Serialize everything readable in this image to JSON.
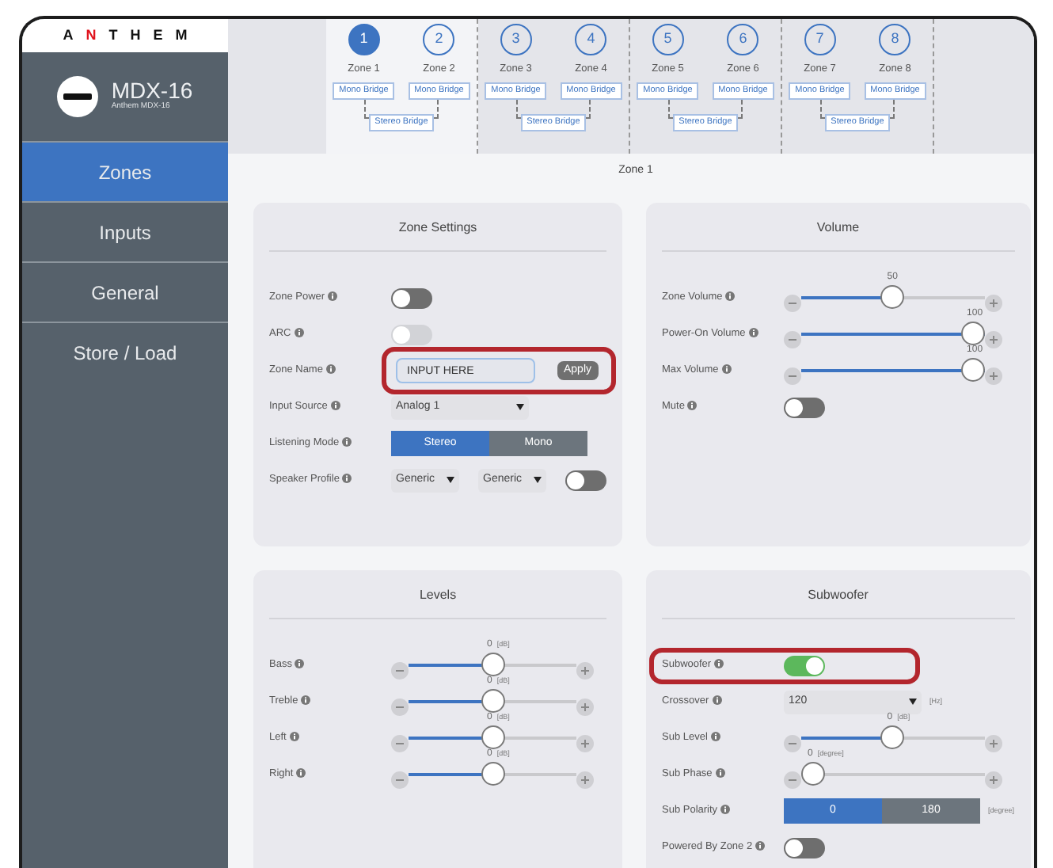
{
  "logo": {
    "letters": [
      {
        "char": "A",
        "accent": false
      },
      {
        "char": "N",
        "accent": true
      },
      {
        "char": "T",
        "accent": false
      },
      {
        "char": "H",
        "accent": false
      },
      {
        "char": "E",
        "accent": false
      },
      {
        "char": "M",
        "accent": false
      }
    ]
  },
  "device": {
    "name": "MDX-16",
    "model": "Anthem MDX-16"
  },
  "nav": [
    {
      "label": "Zones",
      "selected": true
    },
    {
      "label": "Inputs",
      "selected": false
    },
    {
      "label": "General",
      "selected": false
    },
    {
      "label": "Store / Load",
      "selected": false
    }
  ],
  "zone_groups": [
    {
      "selected": true,
      "stereo_bridge": "Stereo Bridge",
      "zones": [
        {
          "number": "1",
          "label": "Zone 1",
          "selected": true,
          "bridge": "Mono Bridge"
        },
        {
          "number": "2",
          "label": "Zone 2",
          "selected": false,
          "bridge": "Mono Bridge"
        }
      ]
    },
    {
      "selected": false,
      "stereo_bridge": "Stereo Bridge",
      "zones": [
        {
          "number": "3",
          "label": "Zone 3",
          "selected": false,
          "bridge": "Mono Bridge"
        },
        {
          "number": "4",
          "label": "Zone 4",
          "selected": false,
          "bridge": "Mono Bridge"
        }
      ]
    },
    {
      "selected": false,
      "stereo_bridge": "Stereo Bridge",
      "zones": [
        {
          "number": "5",
          "label": "Zone 5",
          "selected": false,
          "bridge": "Mono Bridge"
        },
        {
          "number": "6",
          "label": "Zone 6",
          "selected": false,
          "bridge": "Mono Bridge"
        }
      ]
    },
    {
      "selected": false,
      "stereo_bridge": "Stereo Bridge",
      "zones": [
        {
          "number": "7",
          "label": "Zone 7",
          "selected": false,
          "bridge": "Mono Bridge"
        },
        {
          "number": "8",
          "label": "Zone 8",
          "selected": false,
          "bridge": "Mono Bridge"
        }
      ]
    }
  ],
  "page_title": "Zone 1",
  "panels": [
    {
      "title": "Zone Settings",
      "rows": [
        {
          "kind": "toggle",
          "label": "Zone Power",
          "on": false,
          "disabled": false,
          "highlighted": false
        },
        {
          "kind": "toggle",
          "label": "ARC",
          "on": false,
          "disabled": true,
          "highlighted": false
        },
        {
          "kind": "text",
          "label": "Zone Name",
          "value": "INPUT HERE",
          "button": "Apply",
          "highlighted": true
        },
        {
          "kind": "select",
          "label": "Input Source",
          "value": "Analog 1",
          "highlighted": false
        },
        {
          "kind": "segmented",
          "label": "Listening Mode",
          "options": [
            {
              "label": "Stereo",
              "selected": true
            },
            {
              "label": "Mono",
              "selected": false
            }
          ],
          "highlighted": false
        },
        {
          "kind": "speaker",
          "label": "Speaker Profile",
          "selects": [
            "Generic",
            "Generic"
          ],
          "on": false,
          "highlighted": false
        }
      ]
    },
    {
      "title": "Volume",
      "rows": [
        {
          "kind": "slider",
          "label": "Zone Volume",
          "value": "50",
          "level": 0.5,
          "highlighted": false
        },
        {
          "kind": "slider",
          "label": "Power-On Volume",
          "value": "100",
          "level": 1,
          "highlighted": false
        },
        {
          "kind": "slider",
          "label": "Max Volume",
          "value": "100",
          "level": 1,
          "highlighted": false
        },
        {
          "kind": "toggle",
          "label": "Mute",
          "on": false,
          "disabled": false,
          "highlighted": false
        }
      ]
    },
    {
      "title": "Levels",
      "rows": [
        {
          "kind": "slider",
          "label": "Bass",
          "value": "0",
          "unit": "[dB]",
          "level": 0.5,
          "highlighted": false
        },
        {
          "kind": "slider",
          "label": "Treble",
          "value": "0",
          "unit": "[dB]",
          "level": 0.5,
          "highlighted": false
        },
        {
          "kind": "slider",
          "label": "Left",
          "value": "0",
          "unit": "[dB]",
          "level": 0.5,
          "highlighted": false
        },
        {
          "kind": "slider",
          "label": "Right",
          "value": "0",
          "unit": "[dB]",
          "level": 0.5,
          "highlighted": false
        }
      ]
    },
    {
      "title": "Subwoofer",
      "rows": [
        {
          "kind": "toggle",
          "label": "Subwoofer",
          "on": true,
          "disabled": false,
          "highlighted": true
        },
        {
          "kind": "select",
          "label": "Crossover",
          "value": "120",
          "unit": "[Hz]",
          "highlighted": false
        },
        {
          "kind": "slider",
          "label": "Sub Level",
          "value": "0",
          "unit": "[dB]",
          "level": 0.5,
          "highlighted": false
        },
        {
          "kind": "slider",
          "label": "Sub Phase",
          "value": "0",
          "unit": "[degree]",
          "level": 0,
          "highlighted": false
        },
        {
          "kind": "segmented",
          "label": "Sub Polarity",
          "options": [
            {
              "label": "0",
              "selected": true
            },
            {
              "label": "180",
              "selected": false
            }
          ],
          "unit": "[degree]",
          "highlighted": false
        },
        {
          "kind": "toggle",
          "label": "Powered By Zone 2",
          "on": false,
          "disabled": false,
          "highlighted": false
        }
      ]
    }
  ]
}
